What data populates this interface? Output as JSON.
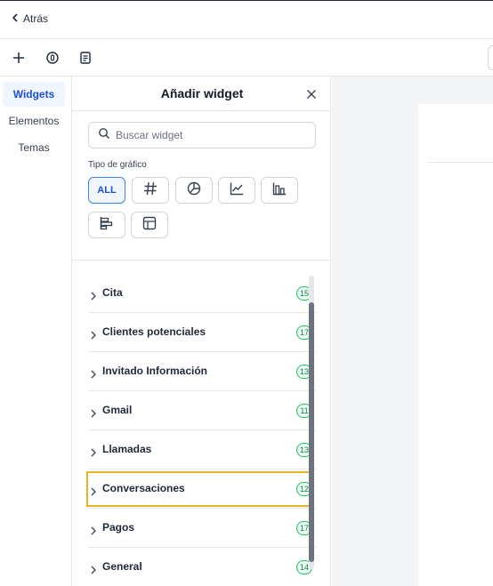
{
  "topbar": {
    "back_label": "Atrás"
  },
  "toolbar": {
    "icons": [
      "plus-icon",
      "coin-icon",
      "document-icon"
    ]
  },
  "nav": {
    "items": [
      {
        "label": "Widgets",
        "active": true
      },
      {
        "label": "Elementos",
        "active": false
      },
      {
        "label": "Temas",
        "active": false
      }
    ]
  },
  "panel": {
    "title": "Añadir widget",
    "search": {
      "placeholder": "Buscar widget",
      "value": ""
    },
    "chart_type_label": "Tipo de gráfico",
    "chart_types": [
      {
        "label": "ALL",
        "icon": null,
        "active": true
      },
      {
        "label": "",
        "icon": "hash-icon",
        "active": false
      },
      {
        "label": "",
        "icon": "pie-chart-icon",
        "active": false
      },
      {
        "label": "",
        "icon": "line-chart-icon",
        "active": false
      },
      {
        "label": "",
        "icon": "bar-chart-icon",
        "active": false
      },
      {
        "label": "",
        "icon": "horizontal-bar-chart-icon",
        "active": false
      },
      {
        "label": "",
        "icon": "table-icon",
        "active": false
      }
    ],
    "categories": [
      {
        "name": "Cita",
        "count": "15"
      },
      {
        "name": "Clientes potenciales",
        "count": "17"
      },
      {
        "name": "Invitado Información",
        "count": "13"
      },
      {
        "name": "Gmail",
        "count": "11"
      },
      {
        "name": "Llamadas",
        "count": "13"
      },
      {
        "name": "Conversaciones",
        "count": "12"
      },
      {
        "name": "Pagos",
        "count": "17"
      },
      {
        "name": "General",
        "count": "14"
      }
    ],
    "highlighted_category": "Conversaciones"
  },
  "colors": {
    "accent": "#1d4ed8",
    "badge_green": "#22c55e",
    "highlight": "#e6b422"
  }
}
